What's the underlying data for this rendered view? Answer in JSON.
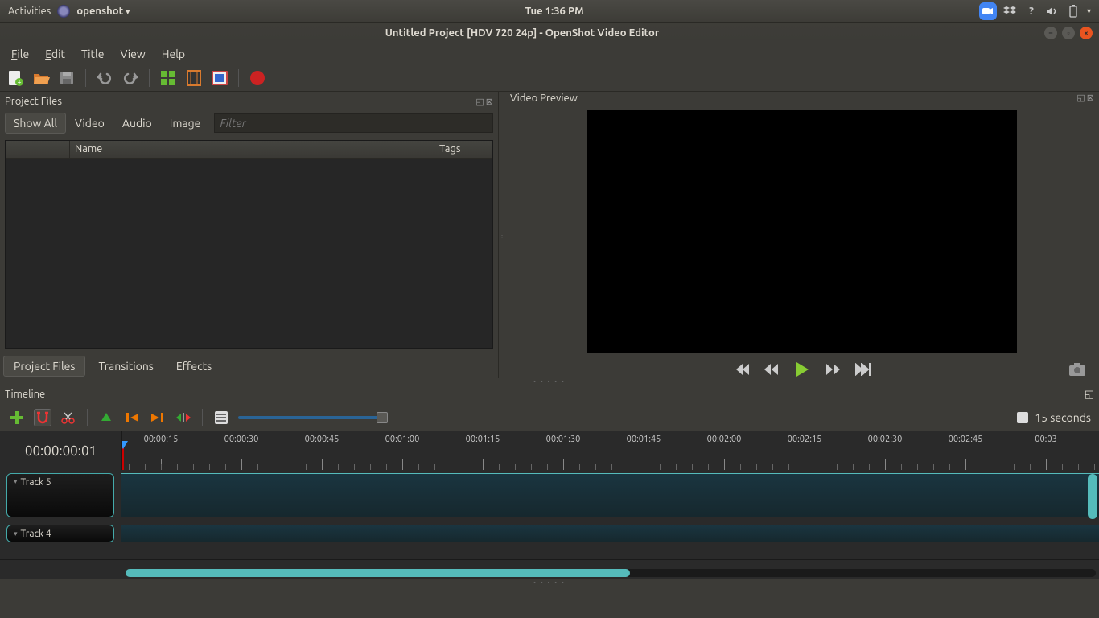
{
  "topbar": {
    "activities": "Activities",
    "app": "openshot",
    "clock": "Tue  1:36 PM"
  },
  "window": {
    "title": "Untitled Project [HDV 720 24p] - OpenShot Video Editor"
  },
  "menu": {
    "file": "File",
    "edit": "Edit",
    "title": "Title",
    "view": "View",
    "help": "Help"
  },
  "panels": {
    "project_files": {
      "title": "Project Files",
      "tabs": {
        "all": "Show All",
        "video": "Video",
        "audio": "Audio",
        "image": "Image"
      },
      "filter_ph": "Filter",
      "cols": {
        "name": "Name",
        "tags": "Tags"
      }
    },
    "preview": {
      "title": "Video Preview"
    }
  },
  "bottom_tabs": {
    "project_files": "Project Files",
    "transitions": "Transitions",
    "effects": "Effects"
  },
  "timeline": {
    "title": "Timeline",
    "timecode": "00:00:00:01",
    "duration": "15 seconds",
    "marks": [
      "00:00:15",
      "00:00:30",
      "00:00:45",
      "00:01:00",
      "00:01:15",
      "00:01:30",
      "00:01:45",
      "00:02:00",
      "00:02:15",
      "00:02:30",
      "00:02:45",
      "00:03"
    ],
    "tracks": [
      "Track 5",
      "Track 4"
    ]
  }
}
